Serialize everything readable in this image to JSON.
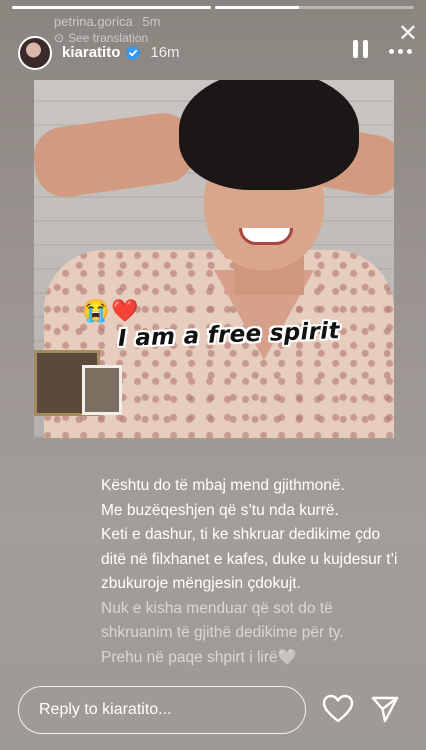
{
  "story": {
    "progress": [
      1.0,
      0.42
    ],
    "repost": {
      "username": "petrina.gorica",
      "time": "5m",
      "translation": "See translation"
    },
    "header": {
      "username": "kiaratito",
      "time": "16m",
      "pause_icon": "pause-icon",
      "more_icon": "more-icon",
      "close_icon": "close-icon"
    },
    "sticker_emojis": [
      "😭",
      "❤️"
    ],
    "sticker_text": "I am a free spirit",
    "caption": {
      "lines": [
        "Kështu do të mbaj mend gjithmonë.",
        "Me buzëqeshjen që s’tu nda kurrë.",
        "Keti e dashur, ti ke shkruar dedikime çdo ditë në filxhanet e kafes, duke u kujdesur t’i zbukuroje mëngjesin çdokujt."
      ],
      "faded_lines": [
        "Nuk e kisha menduar që sot do të shkruanim të gjithë dedikime për ty.",
        "Prehu në paqe shpirt i lirë🤍"
      ]
    },
    "footer": {
      "reply_placeholder": "Reply to kiaratito...",
      "heart_icon": "heart-icon",
      "send_icon": "send-icon"
    },
    "colors": {
      "background": "#9a938f",
      "text": "#ffffff",
      "verified": "#3897f0"
    }
  }
}
